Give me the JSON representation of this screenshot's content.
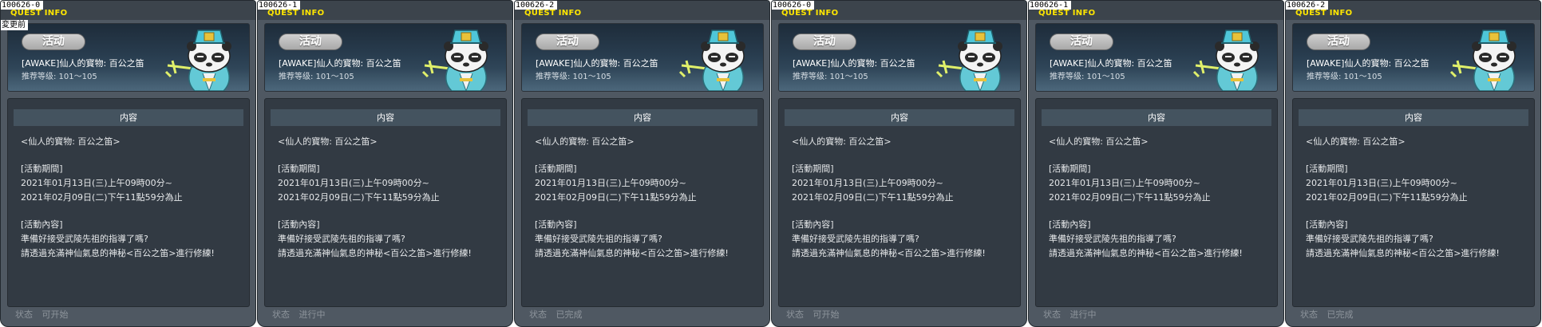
{
  "header_title": "QUEST INFO",
  "tag_label": "活动",
  "quest_name": "[AWAKE]仙人的寳物: 百公之笛",
  "recommended_level": "推荐等级: 101～105",
  "content_header": "内容",
  "status_label": "状态",
  "badge_before": "変更前",
  "content_lines": [
    "<仙人的寳物: 百公之笛>",
    "",
    "[活動期間]",
    "2021年01月13日(三)上午09時00分~",
    "2021年02月09日(二)下午11點59分為止",
    "",
    "[活動內容]",
    "準備好接受武陵先祖的指導了嗎?",
    "請透過充滿神仙氣息的神秘<百公之笛>進行修練!"
  ],
  "panels": [
    {
      "id": "100626-0",
      "status": "可开始",
      "has_before_badge": true
    },
    {
      "id": "100626-1",
      "status": "进行中",
      "has_before_badge": false
    },
    {
      "id": "100626-2",
      "status": "已完成",
      "has_before_badge": false
    },
    {
      "id": "100626-0",
      "status": "可开始",
      "has_before_badge": false
    },
    {
      "id": "100626-1",
      "status": "进行中",
      "has_before_badge": false
    },
    {
      "id": "100626-2",
      "status": "已完成",
      "has_before_badge": false
    }
  ],
  "colors": {
    "panel_bg": "#4f5862",
    "header_title": "#ffe600",
    "content_bg": "#323a43",
    "content_head_bg": "#44535f",
    "status_text": "#8e959c"
  },
  "npc_icon": "panda-scholar-npc-icon"
}
